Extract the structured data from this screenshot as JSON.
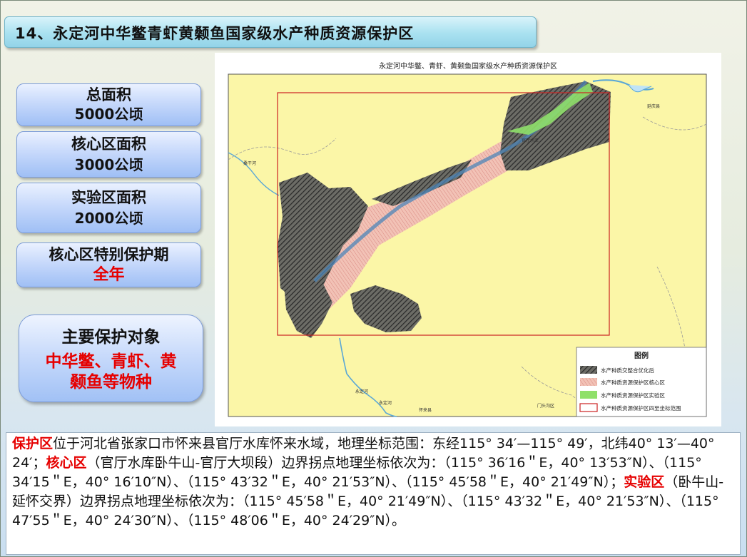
{
  "title": "14、永定河中华鳖青虾黄颡鱼国家级水产种质资源保护区",
  "stats": [
    {
      "label": "总面积",
      "value": "5000公顷"
    },
    {
      "label": "核心区面积",
      "value": "3000公顷"
    },
    {
      "label": "实验区面积",
      "value": "2000公顷"
    },
    {
      "label": "核心区特别保护期",
      "value": "全年"
    }
  ],
  "objects": {
    "label": "主要保护对象",
    "line1": "中华鳖、青虾、黄",
    "line2": "颡鱼等物种"
  },
  "map": {
    "title": "永定河中华鳖、青虾、黄颡鱼国家级水产种质资源保护区",
    "places": [
      "延庆县",
      "桑干河",
      "官厅水库",
      "门头沟区",
      "永定河",
      "永定河",
      "怀来县"
    ],
    "legend": {
      "title": "图例",
      "items": [
        {
          "label": "水产种质交整合优化后",
          "color": "#3c3c3c"
        },
        {
          "label": "水产种质资源保护区核心区",
          "color": "#e69999"
        },
        {
          "label": "水产种质资源保护区实验区",
          "color": "#7fe05a"
        },
        {
          "label": "水产种质资源保护区四至坐标范围",
          "color": "#cc2222"
        }
      ]
    }
  },
  "description": {
    "t1": "保护区",
    "t2": "位于河北省张家口市怀来县官厅水库怀来水域，地理坐标范围：东经115° 34′—115° 49′，北纬40° 13′—40° 24′；",
    "t3": "核心区",
    "t4": "（官厅水库卧牛山-官厅大坝段）边界拐点地理坐标依次为：（115° 36′16＂E，40° 13′53″N）、（115° 34′15＂E，40° 16′10″N）、（115° 43′32＂E，40° 21′53″N）、（115° 45′58＂E，40° 21′49″N）；",
    "t5": "实验区",
    "t6": "（卧牛山-延怀交界）边界拐点地理坐标依次为：（115° 45′58＂E，40° 21′49″N）、（115° 43′32＂E，40° 21′53″N）、（115° 47′55＂E，40° 24′30″N）、（115° 48′06＂E，40° 24′29″N）。"
  }
}
